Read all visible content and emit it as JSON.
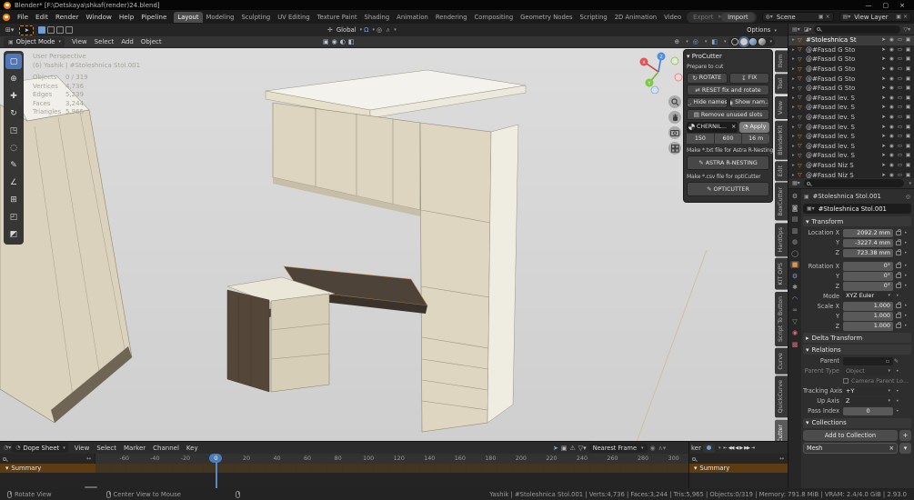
{
  "titlebar": {
    "title": "Blender* [F:\\Detskaya\\shkaf(render)24.blend]",
    "minimize": "—",
    "maximize": "▢",
    "close": "×"
  },
  "topbar": {
    "menus": [
      "File",
      "Edit",
      "Render",
      "Window",
      "Help",
      "Pipeline"
    ],
    "workspaces": [
      "Layout",
      "Modeling",
      "Sculpting",
      "UV Editing",
      "Texture Paint",
      "Shading",
      "Animation",
      "Rendering",
      "Compositing",
      "Geometry Nodes",
      "Scripting",
      "2D Animation",
      "Video Editing",
      "+"
    ],
    "active_workspace": "Layout",
    "export_label": "Export",
    "import_label": "Import",
    "export_arrows": "»",
    "scene": {
      "label": "Scene",
      "new_icon": "▣",
      "unlink_icon": "×"
    },
    "view_layer": {
      "label": "View Layer",
      "new_icon": "▣",
      "unlink_icon": "×"
    }
  },
  "tool_settings": {
    "orientation_label": "Global",
    "options_label": "Options",
    "orientation_icon": "✛",
    "magnet_icon": "Ω",
    "proportional_icon": "◎",
    "falloff_icon": "∧"
  },
  "viewport": {
    "header": {
      "mode": "Object Mode",
      "menus": [
        "View",
        "Select",
        "Add",
        "Object"
      ]
    },
    "mid_icons": [
      {
        "name": "pivot-point-icon",
        "glyph": "▣"
      },
      {
        "name": "snap-target-icon",
        "glyph": "◉"
      },
      {
        "name": "proportional-falloff-icon",
        "glyph": "◐"
      },
      {
        "name": "mode-transfer-icon",
        "glyph": "◧"
      }
    ],
    "toolbar_icons": [
      {
        "name": "box-select",
        "glyph": "▢"
      },
      {
        "name": "cursor",
        "glyph": "⊕"
      },
      {
        "name": "move",
        "glyph": "✚"
      },
      {
        "name": "rotate",
        "glyph": "↻"
      },
      {
        "name": "scale",
        "glyph": "◳"
      },
      {
        "name": "transform",
        "glyph": "◌"
      },
      {
        "name": "annotate",
        "glyph": "✎"
      },
      {
        "name": "measure",
        "glyph": "∠"
      },
      {
        "name": "add-cube",
        "glyph": "⊞"
      },
      {
        "name": "bevel",
        "glyph": "◰"
      },
      {
        "name": "inset",
        "glyph": "◩"
      }
    ],
    "active_tool": "box-select",
    "overlay": {
      "line1": "User Perspective",
      "line2": "(6) Yashik | #Stoleshnica Stol.001",
      "stats": [
        {
          "label": "Objects",
          "value": "0 / 319"
        },
        {
          "label": "Vertices",
          "value": "4,736"
        },
        {
          "label": "Edges",
          "value": "5,239"
        },
        {
          "label": "Faces",
          "value": "3,244"
        },
        {
          "label": "Triangles",
          "value": "5,965"
        }
      ]
    },
    "sidebar_tabs": [
      "Item",
      "Tool",
      "View",
      "BlenderKit",
      "Edit",
      "BoxCutter",
      "HardOps",
      "KIT OPS",
      "Script To Button",
      "Curve",
      "QuickCurve",
      "ProCutter"
    ],
    "active_sidebar_tab": "ProCutter"
  },
  "procutter": {
    "title": "ProCutter",
    "prepare_label": "Prepare to cut",
    "rotate_label": "ROTATE",
    "fix_label": "FIX",
    "reset_label": "RESET fix and rotate",
    "hide_label": "Hide names",
    "show_label": "Show nam...",
    "remove_label": "Remove unused slots",
    "material_name": "CHERNIL...",
    "apply_label": "Apply",
    "fields": [
      "150",
      "600",
      "16 m"
    ],
    "txt_note": "Make *.txt file for Astra R-Nesting",
    "astra_label": "ASTRA R-NESTING",
    "csv_note": "Make *.csv file for optiCutter",
    "opti_label": "OPTICUTTER"
  },
  "outliner": {
    "items": [
      {
        "label": "#Stoleshnica St",
        "selected": true
      },
      {
        "label": "@#Fasad G Sto"
      },
      {
        "label": "@#Fasad G Sto"
      },
      {
        "label": "@#Fasad G Sto"
      },
      {
        "label": "@#Fasad G Sto"
      },
      {
        "label": "@#Fasad G Sto"
      },
      {
        "label": "@#Fasad lev. S"
      },
      {
        "label": "@#Fasad lev. S"
      },
      {
        "label": "@#Fasad lev. S"
      },
      {
        "label": "@#Fasad lev. S"
      },
      {
        "label": "@#Fasad lev. S"
      },
      {
        "label": "@#Fasad lev. S"
      },
      {
        "label": "@#Fasad lev. S"
      },
      {
        "label": "@#Fasad Niz S"
      },
      {
        "label": "@#Fasad Niz S"
      }
    ]
  },
  "properties": {
    "tabs": [
      {
        "name": "tool",
        "glyph": "⚙",
        "color": "#b0b0b0"
      },
      {
        "name": "render",
        "glyph": "◙",
        "color": "#9a9a9a"
      },
      {
        "name": "output",
        "glyph": "▤",
        "color": "#9a9a9a"
      },
      {
        "name": "view-layer",
        "glyph": "▥",
        "color": "#9a9a9a"
      },
      {
        "name": "scene",
        "glyph": "◍",
        "color": "#9a9a9a"
      },
      {
        "name": "world",
        "glyph": "◯",
        "color": "#9a9a9a"
      },
      {
        "name": "object",
        "glyph": "■",
        "color": "#e8943d"
      },
      {
        "name": "modifiers",
        "glyph": "⚙",
        "color": "#7aa5d8"
      },
      {
        "name": "particles",
        "glyph": "✱",
        "color": "#9a9a9a"
      },
      {
        "name": "physics",
        "glyph": "◠",
        "color": "#7aa5d8"
      },
      {
        "name": "constraints",
        "glyph": "∞",
        "color": "#9a9a9a"
      },
      {
        "name": "data",
        "glyph": "▽",
        "color": "#6cc06c"
      },
      {
        "name": "material",
        "glyph": "◉",
        "color": "#d96a6a"
      },
      {
        "name": "texture",
        "glyph": "▩",
        "color": "#d96a6a"
      }
    ],
    "active_tab": "object",
    "breadcrumb": "#Stoleshnica Stol.001",
    "object_name": "#Stoleshnica Stol.001",
    "transform": {
      "section": "Transform",
      "location_rows": [
        {
          "label": "Location X",
          "value": "2092.2 mm"
        },
        {
          "label": "Y",
          "value": "-3227.4 mm"
        },
        {
          "label": "Z",
          "value": "723.38 mm"
        }
      ],
      "rotation_rows": [
        {
          "label": "Rotation X",
          "value": "0°"
        },
        {
          "label": "Y",
          "value": "0°"
        },
        {
          "label": "Z",
          "value": "0°"
        }
      ],
      "mode_label": "Mode",
      "mode_value": "XYZ Euler",
      "scale_rows": [
        {
          "label": "Scale X",
          "value": "1.000"
        },
        {
          "label": "Y",
          "value": "1.000"
        },
        {
          "label": "Z",
          "value": "1.000"
        }
      ]
    },
    "delta_label": "Delta Transform",
    "relations": {
      "section": "Relations",
      "parent_label": "Parent",
      "parent_type_label": "Parent Type",
      "parent_type_value": "Object",
      "camera_parent_label": "Camera Parent Lo...",
      "tracking_label": "Tracking Axis",
      "tracking_value": "+Y",
      "up_label": "Up Axis",
      "up_value": "Z",
      "pass_label": "Pass Index",
      "pass_value": "0"
    },
    "collections": {
      "section": "Collections",
      "add_label": "Add to Collection",
      "plus": "+",
      "item": "Mesh"
    }
  },
  "dopesheet": {
    "editor": "Dope Sheet",
    "menus": [
      "View",
      "Select",
      "Marker",
      "Channel",
      "Key"
    ],
    "snap_value": "Nearest Frame",
    "ticks": [
      "-60",
      "-40",
      "-20",
      "0",
      "20",
      "40",
      "60",
      "80",
      "100",
      "120",
      "140",
      "160",
      "180",
      "200",
      "220",
      "240",
      "260",
      "280",
      "300"
    ],
    "current_frame": "0",
    "summary_label": "Summary"
  },
  "timeline": {
    "partial_menu": "ker",
    "playback": [
      {
        "name": "jump-to-start",
        "glyph": "⇤"
      },
      {
        "name": "previous-keyframe",
        "glyph": "◀◀"
      },
      {
        "name": "play-reverse",
        "glyph": "◀"
      },
      {
        "name": "play",
        "glyph": "▶"
      },
      {
        "name": "next-keyframe",
        "glyph": "▶▶"
      },
      {
        "name": "jump-to-end",
        "glyph": "⇥"
      }
    ],
    "summary_label": "Summary"
  },
  "statusbar": {
    "hint1": "Rotate View",
    "hint2": "Center View to Mouse",
    "right": "Yashik | #Stoleshnica Stol.001 | Verts:4,736 | Faces:3,244 | Tris:5,965 | Objects:0/319 | Memory: 791.8 MiB | VRAM: 2.4/4.0 GiB | 2.93.0"
  },
  "colors": {
    "accent_blue": "#4a7cc0",
    "object_orange": "#e8943d",
    "summary_brown": "#5e3c12",
    "viewport_bg": "#d6d6d6",
    "furniture_cream": "#ddd5bf",
    "furniture_dark_wood": "#4d4338"
  }
}
